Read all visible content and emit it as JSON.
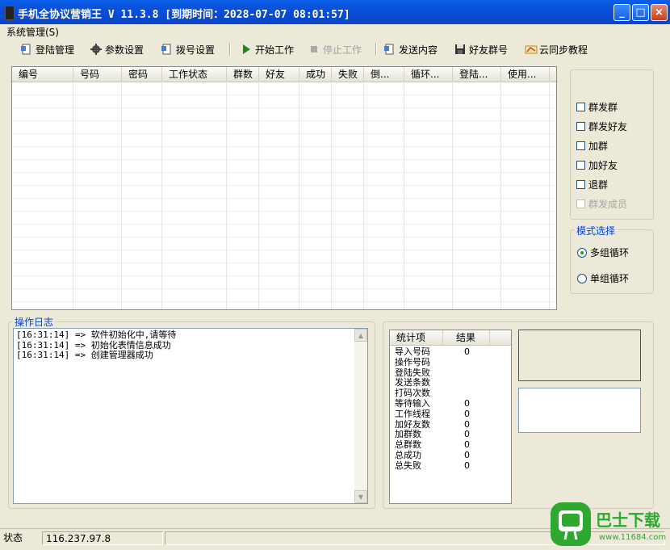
{
  "window": {
    "title": "手机全协议营销王 V 11.3.8 [到期时间：2028-07-07 08:01:57]",
    "minimize": "_",
    "maximize": "□",
    "close": "×"
  },
  "menu": {
    "system": "系统管理(S)"
  },
  "toolbar": {
    "login": "登陆管理",
    "params": "参数设置",
    "dial": "拨号设置",
    "start": "开始工作",
    "stop": "停止工作",
    "send": "发送内容",
    "friends": "好友群号",
    "cloud": "云同步教程"
  },
  "grid": {
    "columns": [
      "编号",
      "号码",
      "密码",
      "工作状态",
      "群数",
      "好友",
      "成功",
      "失败",
      "倒...",
      "循环...",
      "登陆...",
      "使用..."
    ]
  },
  "options": {
    "items": [
      {
        "label": "群发群",
        "checked": false,
        "enabled": true
      },
      {
        "label": "群发好友",
        "checked": false,
        "enabled": true
      },
      {
        "label": "加群",
        "checked": false,
        "enabled": true
      },
      {
        "label": "加好友",
        "checked": false,
        "enabled": true
      },
      {
        "label": "退群",
        "checked": false,
        "enabled": true
      },
      {
        "label": "群发成员",
        "checked": false,
        "enabled": false
      }
    ]
  },
  "mode": {
    "title": "模式选择",
    "multi": "多组循环",
    "single": "单组循环",
    "selected": "multi"
  },
  "log": {
    "title": "操作日志",
    "lines": [
      "[16:31:14] => 软件初始化中,请等待",
      "[16:31:14] => 初始化表情信息成功",
      "[16:31:14] => 创建管理器成功"
    ]
  },
  "stats": {
    "col_item": "统计项",
    "col_result": "结果",
    "rows": [
      {
        "label": "导入号码",
        "value": "0"
      },
      {
        "label": "操作号码",
        "value": ""
      },
      {
        "label": "登陆失败",
        "value": ""
      },
      {
        "label": "发送条数",
        "value": ""
      },
      {
        "label": "打码次数",
        "value": ""
      },
      {
        "label": "等待输入",
        "value": "0"
      },
      {
        "label": "工作线程",
        "value": "0"
      },
      {
        "label": "加好友数",
        "value": "0"
      },
      {
        "label": "加群数",
        "value": "0"
      },
      {
        "label": "总群数",
        "value": "0"
      },
      {
        "label": "总成功",
        "value": "0"
      },
      {
        "label": "总失败",
        "value": "0"
      }
    ]
  },
  "status": {
    "label": "状态",
    "ip": "116.237.97.8"
  },
  "watermark": {
    "brand": "巴士下载",
    "url": "www.11684.com"
  },
  "colors": {
    "title_bar": "#0b4ed8",
    "group_title": "#0046d5",
    "watermark": "#2ea82e"
  }
}
